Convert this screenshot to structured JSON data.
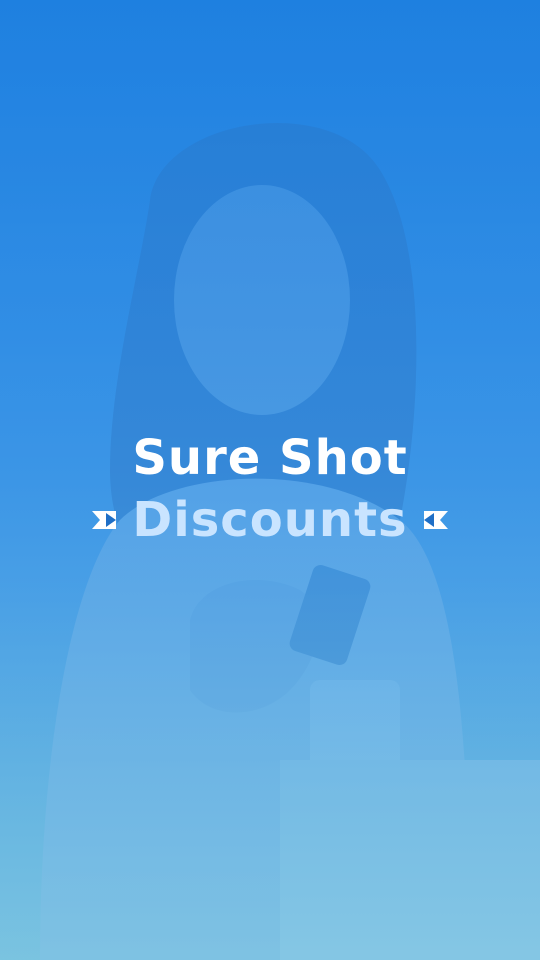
{
  "splash": {
    "title_line1": "Sure Shot",
    "title_line2": "Discounts"
  },
  "colors": {
    "background_top": "#1f80e0",
    "background_bottom": "#7cc4e0",
    "title_primary": "#ffffff",
    "title_secondary": "#c9e4ff"
  },
  "icons": {
    "left_ribbon": "ribbon-left-icon",
    "right_ribbon": "ribbon-right-icon"
  }
}
